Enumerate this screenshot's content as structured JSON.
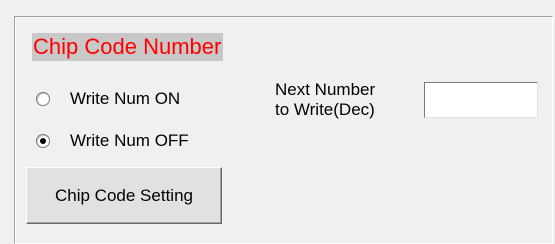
{
  "group": {
    "title": "Chip Code Number",
    "title_color": "#ff0000",
    "title_background": "#c8c8c8"
  },
  "radios": [
    {
      "label": "Write Num ON",
      "selected": false
    },
    {
      "label": "Write Num OFF",
      "selected": true
    }
  ],
  "next_number": {
    "label_line1": "Next Number",
    "label_line2": "to Write(Dec)",
    "value": ""
  },
  "button": {
    "label": "Chip Code Setting"
  }
}
